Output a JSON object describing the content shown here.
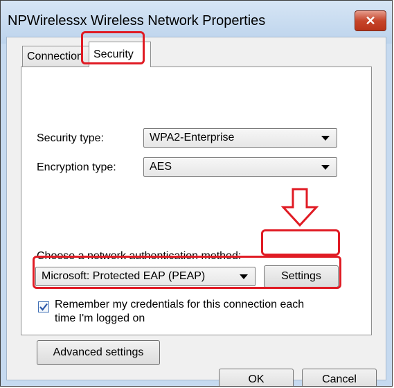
{
  "window": {
    "title": "NPWirelessx Wireless Network Properties",
    "close_glyph": "✕"
  },
  "tabs": [
    {
      "label": "Connection",
      "selected": false
    },
    {
      "label": "Security",
      "selected": true
    }
  ],
  "security": {
    "security_type_label": "Security type:",
    "security_type_value": "WPA2-Enterprise",
    "encryption_type_label": "Encryption type:",
    "encryption_type_value": "AES",
    "auth_method_label": "Choose a network authentication method:",
    "auth_method_value": "Microsoft: Protected EAP (PEAP)",
    "settings_button": "Settings",
    "remember_line1": "Remember my credentials for this connection each",
    "remember_line2": "time I'm logged on",
    "remember_checked": true,
    "advanced_button": "Advanced settings"
  },
  "footer": {
    "ok_button": "OK",
    "cancel_button": "Cancel"
  },
  "annotations": {
    "highlight_color": "#e01b24"
  }
}
